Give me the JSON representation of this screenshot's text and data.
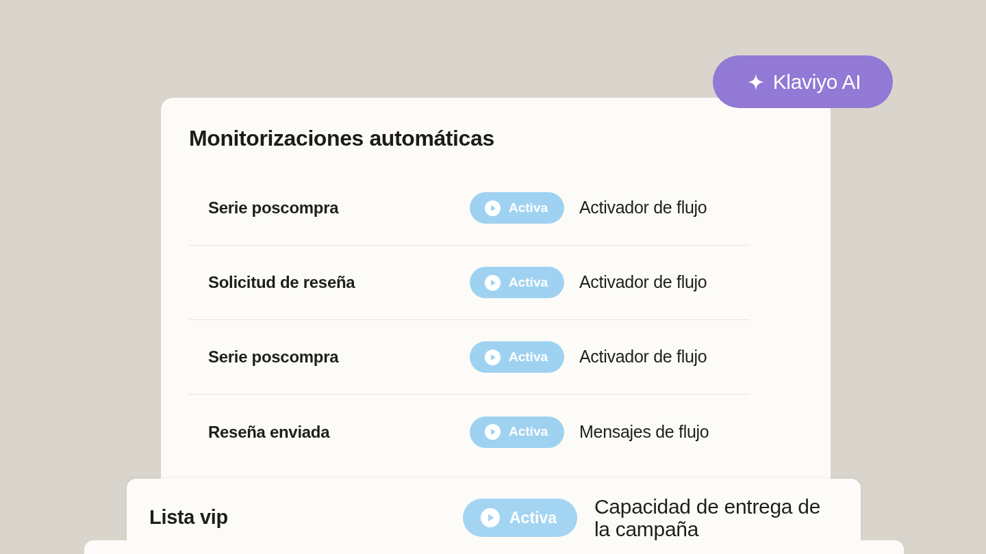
{
  "ai_button": {
    "label": "Klaviyo AI"
  },
  "panel": {
    "title": "Monitorizaciones automáticas",
    "rows": [
      {
        "name": "Serie poscompra",
        "status": "Activa",
        "trigger": "Activador de flujo"
      },
      {
        "name": "Solicitud de reseña",
        "status": "Activa",
        "trigger": "Activador de flujo"
      },
      {
        "name": "Serie poscompra",
        "status": "Activa",
        "trigger": "Activador de flujo"
      },
      {
        "name": "Reseña enviada",
        "status": "Activa",
        "trigger": "Mensajes de flujo"
      }
    ]
  },
  "front_card": {
    "name": "Lista vip",
    "status": "Activa",
    "trigger": "Capacidad de entrega de la campaña"
  }
}
